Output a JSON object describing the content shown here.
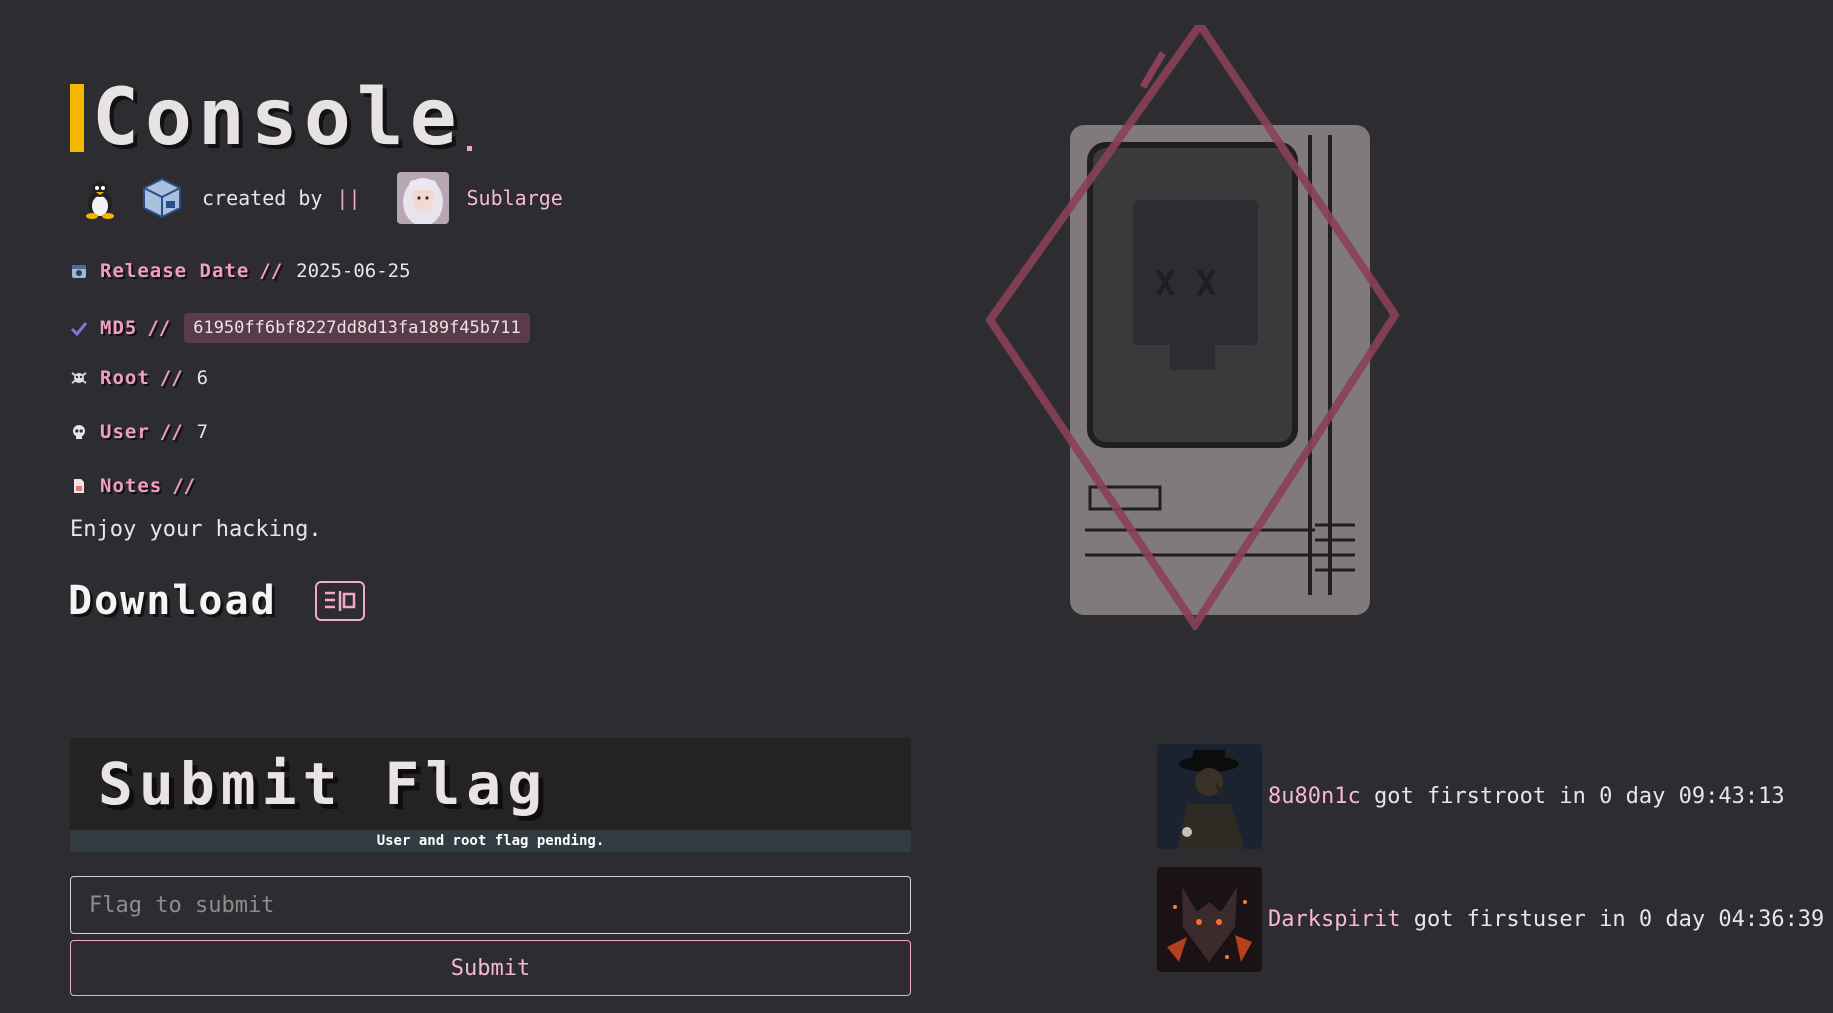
{
  "machine": {
    "title": "Console"
  },
  "creator": {
    "label": "created by",
    "separator": "||",
    "name": "Sublarge",
    "os_icon": "linux-tux-icon",
    "platform_icon": "virtualbox-icon"
  },
  "info": {
    "release": {
      "label": "Release Date",
      "sep": "//",
      "value": "2025-06-25"
    },
    "md5": {
      "label": "MD5",
      "sep": "//",
      "value": "61950ff6bf8227dd8d13fa189f45b711"
    },
    "root": {
      "label": "Root",
      "sep": "//",
      "value": "6"
    },
    "user": {
      "label": "User",
      "sep": "//",
      "value": "7"
    },
    "notes": {
      "label": "Notes",
      "sep": "//",
      "value": "Enjoy your hacking."
    }
  },
  "download": {
    "label": "Download"
  },
  "flag": {
    "title": "Submit Flag",
    "status": "User and root flag pending.",
    "placeholder": "Flag to submit",
    "submit_label": "Submit"
  },
  "bloods": [
    {
      "user": "8u80n1c",
      "action": "got firstroot in 0 day 09:43:13"
    },
    {
      "user": "Darkspirit",
      "action": "got firstuser in 0 day 04:36:39"
    }
  ],
  "colors": {
    "accent": "#f5b800",
    "pink": "#f2a8c8",
    "background": "#2d2c31"
  }
}
